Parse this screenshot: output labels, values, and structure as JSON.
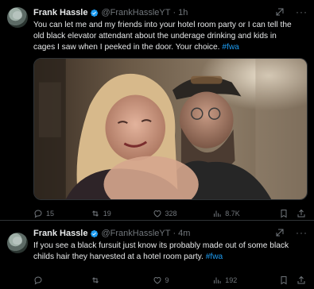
{
  "tweets": [
    {
      "display_name": "Frank Hassle",
      "handle": "@FrankHassleYT",
      "separator": "·",
      "time": "1h",
      "text": "You can let me and my friends into your hotel room party or I can tell the old black elevator attendant about the underage drinking and kids in cages I saw when I peeked in the door. Your choice.",
      "hashtag": "#fwa",
      "stats": {
        "replies": "15",
        "reposts": "19",
        "likes": "328",
        "views": "8.7K"
      }
    },
    {
      "display_name": "Frank Hassle",
      "handle": "@FrankHassleYT",
      "separator": "·",
      "time": "4m",
      "text": "If you see a black fursuit just know its probably made out of some black childs hair they harvested at a hotel room party.",
      "hashtag": "#fwa",
      "stats": {
        "replies": "",
        "reposts": "",
        "likes": "9",
        "views": "192"
      }
    }
  ],
  "icons": {
    "more": "more-icon",
    "grok": "grok-icon",
    "reply": "reply-icon",
    "repost": "repost-icon",
    "like": "like-icon",
    "views": "views-icon",
    "bookmark": "bookmark-icon",
    "share": "share-icon",
    "verified": "verified-badge-icon"
  },
  "colors": {
    "background": "#000000",
    "text": "#e7e9ea",
    "muted": "#71767b",
    "accent": "#1d9bf0",
    "border": "#2f3336"
  }
}
